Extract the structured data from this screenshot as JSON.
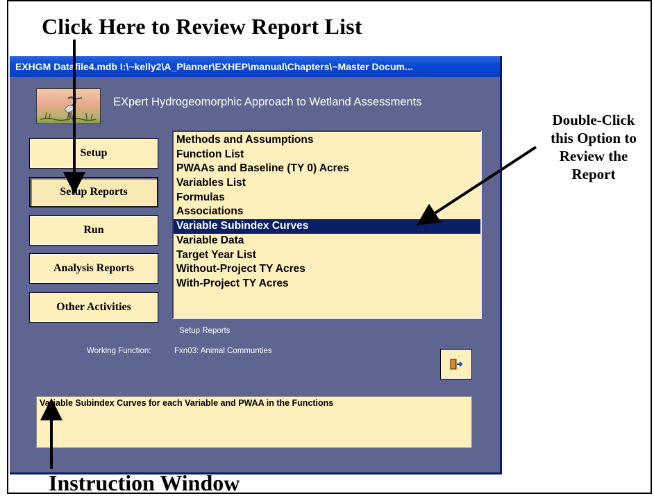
{
  "annotations": {
    "top": "Click Here to Review Report List",
    "right": [
      "Double-Click",
      "this Option to",
      "Review the",
      "Report"
    ],
    "bottom": "Instruction Window"
  },
  "window": {
    "title": "EXHGM   Datafile4.mdb   I:\\~kelly2\\A_Planner\\EXHEP\\manual\\Chapters\\~Master Docum...",
    "app_title": "EXpert Hydrogeomorphic Approach to Wetland Assessments",
    "logo_icon": "heron-wetland-logo",
    "nav_buttons": [
      {
        "label": "Setup",
        "pressed": false
      },
      {
        "label": "Setup Reports",
        "pressed": true
      },
      {
        "label": "Run",
        "pressed": false
      },
      {
        "label": "Analysis Reports",
        "pressed": false
      },
      {
        "label": "Other Activities",
        "pressed": false
      }
    ],
    "report_list": [
      "Methods and Assumptions",
      "Function List",
      "PWAAs and Baseline (TY 0) Acres",
      "Variables List",
      "Formulas",
      "Associations",
      "Variable Subindex Curves",
      "Variable Data",
      "Target Year List",
      "Without-Project TY Acres",
      "With-Project TY Acres"
    ],
    "selected_report": "Variable Subindex Curves",
    "list_caption": "Setup Reports",
    "working_function_label": "Working Function:",
    "working_function_value": "Fxn03: Animal Communties",
    "exit_icon": "exit-door-icon",
    "instruction_text": "Variable Subindex Curves for each Variable and PWAA in the Functions"
  },
  "colors": {
    "window_bg": "#5e6591",
    "titlebar": "#0b4ad6",
    "button_bg": "#fdf0bd",
    "selection": "#0a1f66"
  }
}
